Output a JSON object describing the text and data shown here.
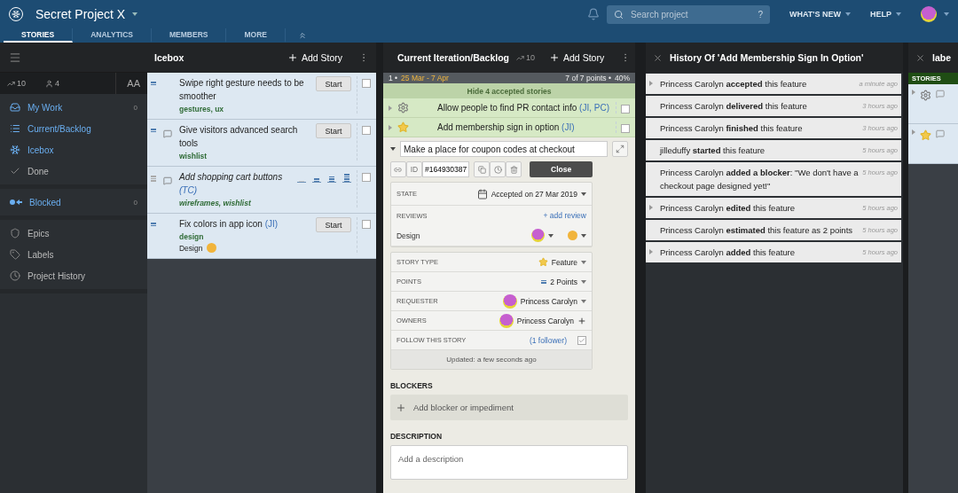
{
  "header": {
    "project_name": "Secret Project X",
    "search_placeholder": "Search project",
    "search_help": "?",
    "menus": [
      "WHAT'S NEW",
      "HELP"
    ],
    "tabs": [
      {
        "label": "STORIES",
        "selected": true
      },
      {
        "label": "ANALYTICS",
        "selected": false
      },
      {
        "label": "MEMBERS",
        "selected": false
      },
      {
        "label": "MORE",
        "selected": false
      }
    ]
  },
  "sidebar": {
    "velocity": "10",
    "members": "4",
    "text_size": "AA",
    "groups": [
      [
        {
          "label": "My Work",
          "count": "0",
          "open": true
        },
        {
          "label": "Current/Backlog",
          "open": true
        },
        {
          "label": "Icebox",
          "open": true
        },
        {
          "label": "Done",
          "open": false
        }
      ],
      [
        {
          "label": "Blocked",
          "count": "0",
          "open": true
        }
      ],
      [
        {
          "label": "Epics",
          "open": false
        },
        {
          "label": "Labels",
          "open": false
        },
        {
          "label": "Project History",
          "open": false
        }
      ]
    ]
  },
  "icebox": {
    "title": "Icebox",
    "add_story": "Add Story",
    "stories": [
      {
        "kind": "start",
        "title": "Swipe right gesture needs to be smoother",
        "labels": "gestures, ux",
        "comment": false,
        "button": "Start",
        "checked": false
      },
      {
        "kind": "start",
        "title": "Give visitors advanced search tools",
        "labels": "wishlist",
        "comment": true,
        "button": "Start",
        "checked": false
      },
      {
        "kind": "estimate",
        "title": "Add shopping cart buttons",
        "owners": "(TC)",
        "labels": "wireframes, wishlist",
        "comment": true,
        "checked": false
      },
      {
        "kind": "start",
        "title": "Fix colors in app icon",
        "owners": "(JI)",
        "labels": "design",
        "review": "Design",
        "comment": false,
        "button": "Start",
        "checked": false
      }
    ]
  },
  "backlog": {
    "title": "Current Iteration/Backlog",
    "velocity": "10",
    "add_story": "Add Story",
    "iteration": {
      "number": "1 •",
      "dates": "25 Mar - 7 Apr",
      "points": "7 of 7 points •",
      "team": "40%"
    },
    "hide_accepted": "Hide 4 accepted stories",
    "accepted": [
      {
        "kind": "chore",
        "title": "Allow people to find PR contact info",
        "owners": "(JI, PC)",
        "checked": false
      },
      {
        "kind": "feature",
        "title": "Add membership sign in option",
        "owners": "(JI)",
        "checked": false
      }
    ],
    "detail": {
      "title": "Make a place for coupon codes at checkout",
      "id_label": "ID",
      "id": "#164930387",
      "close": "Close",
      "state_label": "STATE",
      "state": "Accepted on 27 Mar 2019",
      "reviews_label": "REVIEWS",
      "add_review": "+ add review",
      "review_type": "Design",
      "story_type_label": "STORY TYPE",
      "story_type": "Feature",
      "points_label": "POINTS",
      "points": "2 Points",
      "requester_label": "REQUESTER",
      "requester": "Princess Carolyn",
      "owners_label": "OWNERS",
      "owner": "Princess Carolyn",
      "follow_label": "FOLLOW THIS STORY",
      "followers": "(1 follower)",
      "following": true,
      "updated": "Updated: a few seconds ago",
      "blockers_label": "BLOCKERS",
      "add_blocker": "Add blocker or impediment",
      "description_label": "DESCRIPTION",
      "description_placeholder": "Add a description"
    }
  },
  "history": {
    "title": "History Of 'Add Membership Sign In Option'",
    "entries": [
      {
        "text": "Princess Carolyn **accepted** this feature",
        "time": "a minute ago",
        "expandable": true
      },
      {
        "text": "Princess Carolyn **delivered** this feature",
        "time": "3 hours ago",
        "expandable": false
      },
      {
        "text": "Princess Carolyn **finished** this feature",
        "time": "3 hours ago",
        "expandable": false
      },
      {
        "text": "jilleduffy **started** this feature",
        "time": "5 hours ago",
        "expandable": false
      },
      {
        "text": "Princess Carolyn **added a blocker**: \"We don't have a checkout page designed yet!\"",
        "time": "5 hours ago",
        "expandable": false
      },
      {
        "text": "Princess Carolyn **edited** this feature",
        "time": "5 hours ago",
        "expandable": true
      },
      {
        "text": "Princess Carolyn **estimated** this feature as 2 points",
        "time": "5 hours ago",
        "expandable": false
      },
      {
        "text": "Princess Carolyn **added** this feature",
        "time": "5 hours ago",
        "expandable": true
      }
    ]
  },
  "labels_panel": {
    "title": "labe",
    "section": "STORIES",
    "cards": [
      {
        "kind": "chore"
      },
      {
        "kind": "feature"
      }
    ]
  }
}
